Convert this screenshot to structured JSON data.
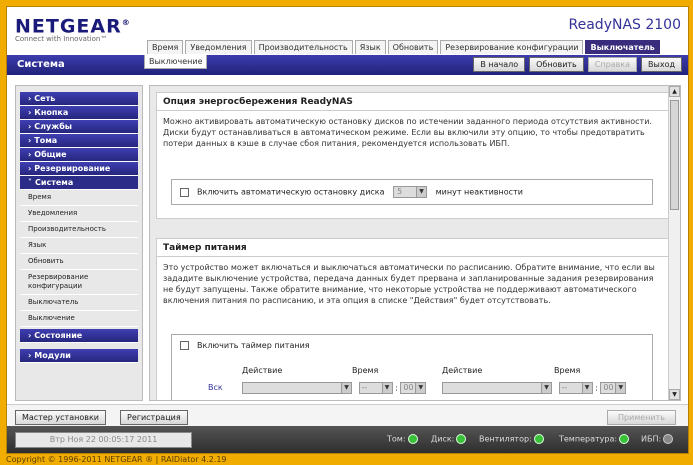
{
  "brand": {
    "name": "NETGEAR",
    "mark": "®",
    "tagline": "Connect with Innovation™"
  },
  "product": "ReadyNAS 2100",
  "tabs": [
    "Время",
    "Уведомления",
    "Производительность",
    "Язык",
    "Обновить",
    "Резервирование конфигурации",
    "Выключатель"
  ],
  "active_tab": "Выключатель",
  "subtab": "Выключение",
  "section_title": "Система",
  "top_buttons": {
    "home": "В начало",
    "refresh": "Обновить",
    "help": "Справка",
    "logout": "Выход"
  },
  "sidebar": {
    "nav": [
      "Сеть",
      "Кнопка",
      "Службы",
      "Тома",
      "Общие",
      "Резервирование",
      "Система"
    ],
    "system_items": [
      "Время",
      "Уведомления",
      "Производительность",
      "Язык",
      "Обновить",
      "Резервирование конфигурации",
      "Выключатель",
      "Выключение"
    ],
    "nav_after": [
      "Состояние",
      "Модули"
    ]
  },
  "power": {
    "title": "Опция энергосбережения ReadyNAS",
    "text": "Можно активировать автоматическую остановку дисков по истечении заданного периода отсутствия активности. Диски будут останавливаться в автоматическом режиме. Если вы включили эту опцию, то чтобы предотвратить потери данных в кэше в случае сбоя питания, рекомендуется использовать ИБП.",
    "checkbox_label": "Включить автоматическую остановку диска",
    "minutes_value": "5",
    "minutes_suffix": "минут неактивности"
  },
  "timer": {
    "title": "Таймер питания",
    "text": "Это устройство может включаться и выключаться автоматически по расписанию. Обратите внимание, что если вы зададите выключение устройства, передача данных будет прервана и запланированные задания резервирования не будут запущены. Также обратите внимание, что некоторые устройства не поддерживают автоматического включения питания по расписанию, и эта опция в списке \"Действия\" будет отсутствовать.",
    "checkbox_label": "Включить таймер питания",
    "col_action": "Действие",
    "col_time": "Время",
    "row_label": "Вск",
    "hour": "--",
    "minute": "00"
  },
  "bottom_buttons": {
    "wizard": "Мастер установки",
    "register": "Регистрация",
    "apply": "Применить"
  },
  "status": {
    "datetime": "Втр Ноя 22  00:05:17 2011",
    "indicators": [
      "Том:",
      "Диск:",
      "Вентилятор:",
      "Температура:",
      "ИБП:"
    ]
  },
  "footer": "Copyright © 1996-2011 NETGEAR ® | RAIDiator 4.2.19"
}
